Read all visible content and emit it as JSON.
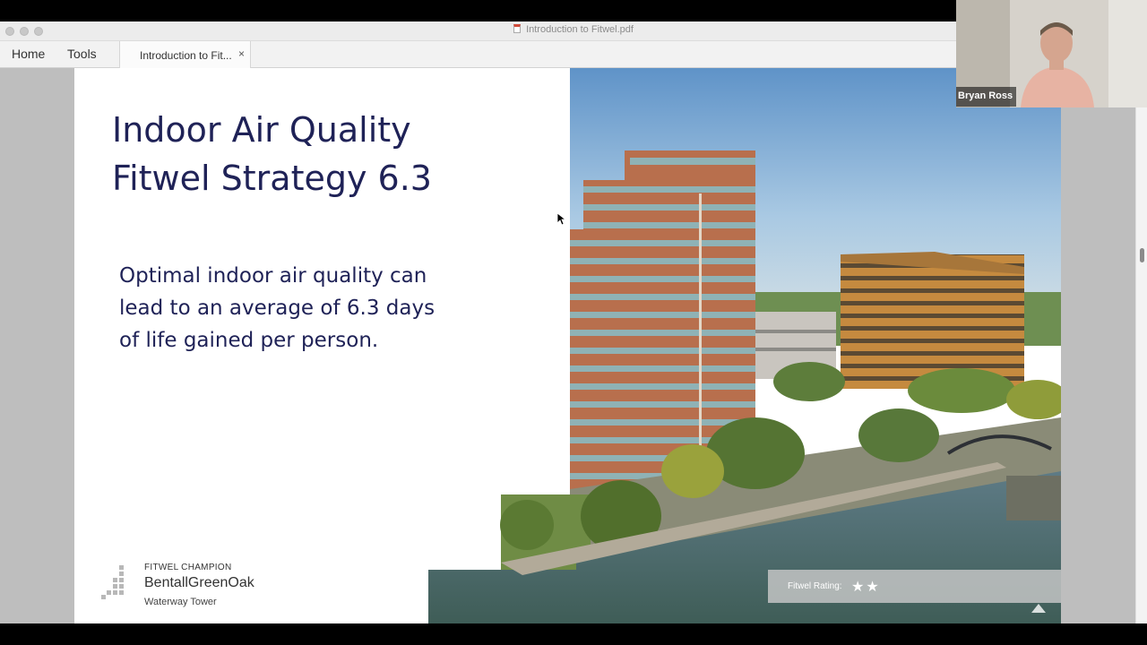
{
  "window": {
    "title": "Introduction to Fitwel.pdf"
  },
  "nav": {
    "home_label": "Home",
    "tools_label": "Tools"
  },
  "tab": {
    "label": "Introduction to Fit...",
    "close_label": "×"
  },
  "slide": {
    "title_line1": "Indoor Air Quality",
    "title_line2": "Fitwel Strategy 6.3",
    "body_line1": "Optimal indoor air quality can",
    "body_line2": "lead to an average of 6.3 days",
    "body_line3": "of life gained per person.",
    "champion_label": "FITWEL CHAMPION",
    "champion_name": "BentallGreenOak",
    "champion_place": "Waterway Tower",
    "rating_label": "Fitwel Rating:",
    "rating_stars": "★★",
    "rating_value": 2
  },
  "participant": {
    "name": "Bryan Ross"
  },
  "colors": {
    "title": "#1f2257",
    "viewer_bg": "#bebebe",
    "tab_bg": "#f2f2f2"
  }
}
